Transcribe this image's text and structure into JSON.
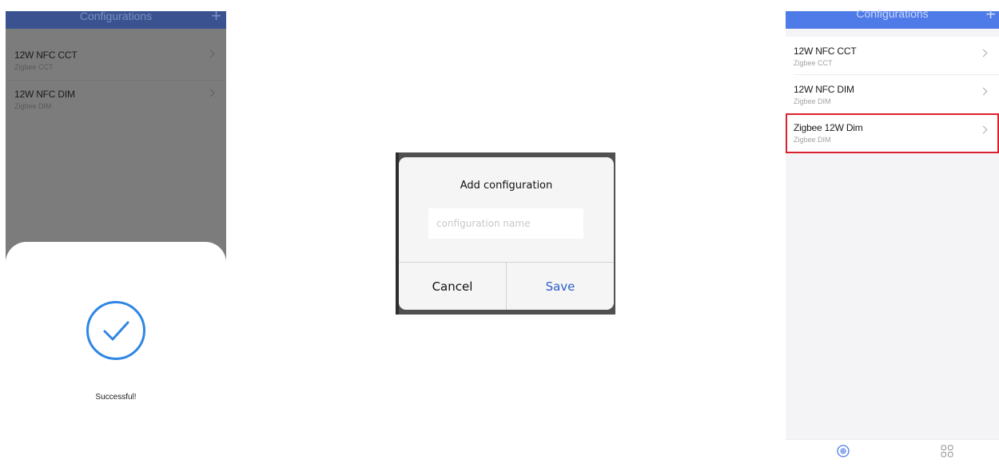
{
  "left_screen": {
    "header": {
      "title": "Configurations",
      "add_icon": "plus-icon"
    },
    "items": [
      {
        "name": "12W NFC CCT",
        "type": "Zigbee CCT"
      },
      {
        "name": "12W NFC DIM",
        "type": "Zigbee DIM"
      }
    ],
    "success": {
      "icon": "check-circle-icon",
      "message": "Successful!"
    }
  },
  "dialog": {
    "title": "Add configuration",
    "input_placeholder": "configuration name",
    "input_value": "",
    "cancel_label": "Cancel",
    "save_label": "Save"
  },
  "right_screen": {
    "header": {
      "title": "Configurations",
      "add_icon": "plus-icon"
    },
    "items": [
      {
        "name": "12W NFC CCT",
        "type": "Zigbee CCT"
      },
      {
        "name": "12W NFC DIM",
        "type": "Zigbee DIM"
      },
      {
        "name": "Zigbee 12W Dim",
        "type": "Zigbee DIM",
        "highlighted": true
      }
    ],
    "bottom_nav": [
      {
        "icon": "home-icon"
      },
      {
        "icon": "grid-icon"
      }
    ]
  },
  "colors": {
    "accent_blue": "#4f7be9",
    "success_blue": "#2f86e6",
    "save_blue": "#2b5fc8",
    "highlight_red": "#d8212c",
    "overlay_gray": "#7c7c7c"
  }
}
